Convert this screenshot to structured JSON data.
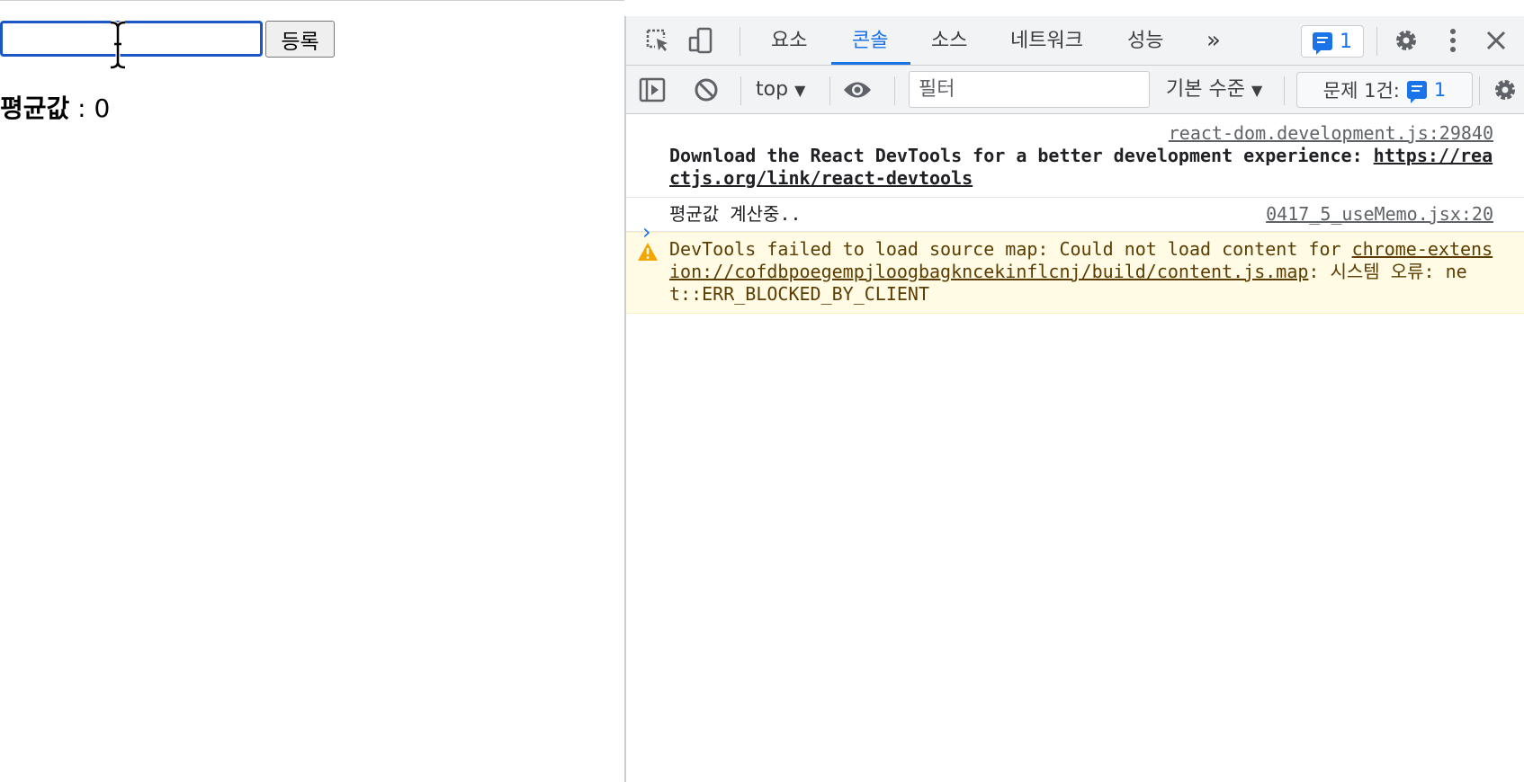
{
  "page": {
    "input_value": "",
    "submit_label": "등록",
    "avg_label": "평균값",
    "avg_sep": " : ",
    "avg_value": "0"
  },
  "devtools": {
    "tabs": [
      {
        "label": "요소"
      },
      {
        "label": "콘솔"
      },
      {
        "label": "소스"
      },
      {
        "label": "네트워크"
      },
      {
        "label": "성능"
      }
    ],
    "active_tab": "콘솔",
    "more_tabs": "»",
    "issues_badge_count": "1",
    "context": "top",
    "filter_placeholder": "필터",
    "level": "기본 수준",
    "issues_label": "문제 1건:",
    "issues_count": "1",
    "accent_color": "#1a73e8",
    "warning_bg": "#fffbe5"
  },
  "console": {
    "messages": [
      {
        "source": "react-dom.development.js:29840",
        "text_bold": "Download the React DevTools for a better development experience: ",
        "link": "https://reactjs.org/link/react-devtools"
      },
      {
        "source": "0417_5_useMemo.jsx:20",
        "text": "평균값 계산중.."
      },
      {
        "level": "warning",
        "text_before": "DevTools failed to load source map: Could not load content for ",
        "link": "chrome-extension://cofdbpoegempjloogbagkncekinflcnj/build/content.js.map",
        "text_after": ": 시스템 오류: net::ERR_BLOCKED_BY_CLIENT"
      }
    ],
    "prompt_glyph": "›"
  }
}
